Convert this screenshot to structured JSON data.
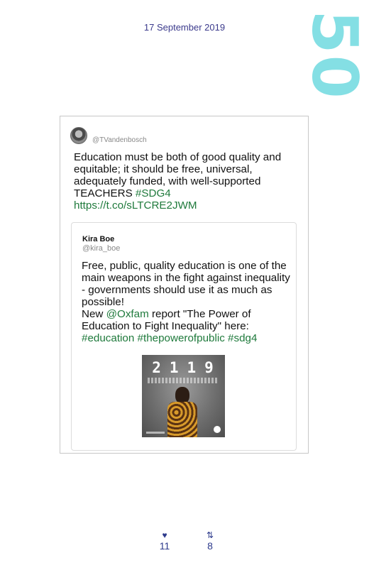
{
  "header": {
    "date": "17 September 2019",
    "page_number": "50"
  },
  "tweet": {
    "handle": "@TVandenbosch",
    "text_plain": "Education must be both of good quality and equitable; it should be free, universal, adequately funded, with well-supported TEACHERS ",
    "hashtag": "#SDG4",
    "link": "https://t.co/sLTCRE2JWM",
    "quoted": {
      "name": "Kira Boe",
      "handle": "@kira_boe",
      "text_1": "Free, public, quality education is one of the main weapons in the fight against inequality - governments should use it as much as possible!",
      "text_2a": "New ",
      "mention": "@Oxfam",
      "text_2b": " report \"The Power of Education to Fight Inequality\" here:",
      "hashtags": "#education #thepowerofpublic #sdg4",
      "image_number": "2119"
    }
  },
  "stats": {
    "likes": "11",
    "retweets": "8",
    "like_icon": "heart-icon",
    "retweet_icon": "retweet-icon"
  },
  "colors": {
    "accent_text": "#3b3a8c",
    "link_green": "#1f7a3c",
    "page_number": "#84dfe4"
  }
}
